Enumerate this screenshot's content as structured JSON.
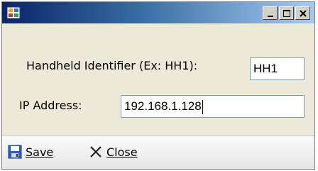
{
  "window": {
    "title": "",
    "buttons": {
      "minimize": "minimize-icon",
      "maximize": "maximize-icon",
      "close": "close-icon"
    }
  },
  "form": {
    "handheld_label": "Handheld Identifier (Ex: HH1):",
    "handheld_value": "HH1",
    "ip_label": "IP Address:",
    "ip_value": "192.168.1.128"
  },
  "toolbar": {
    "save_label": "Save",
    "save_icon": "floppy-disk-icon",
    "close_label": "Close",
    "close_icon": "close-x-icon"
  },
  "colors": {
    "titlebar_start": "#0a246a",
    "titlebar_end": "#a6caf0",
    "window_face": "#ece9d8"
  }
}
